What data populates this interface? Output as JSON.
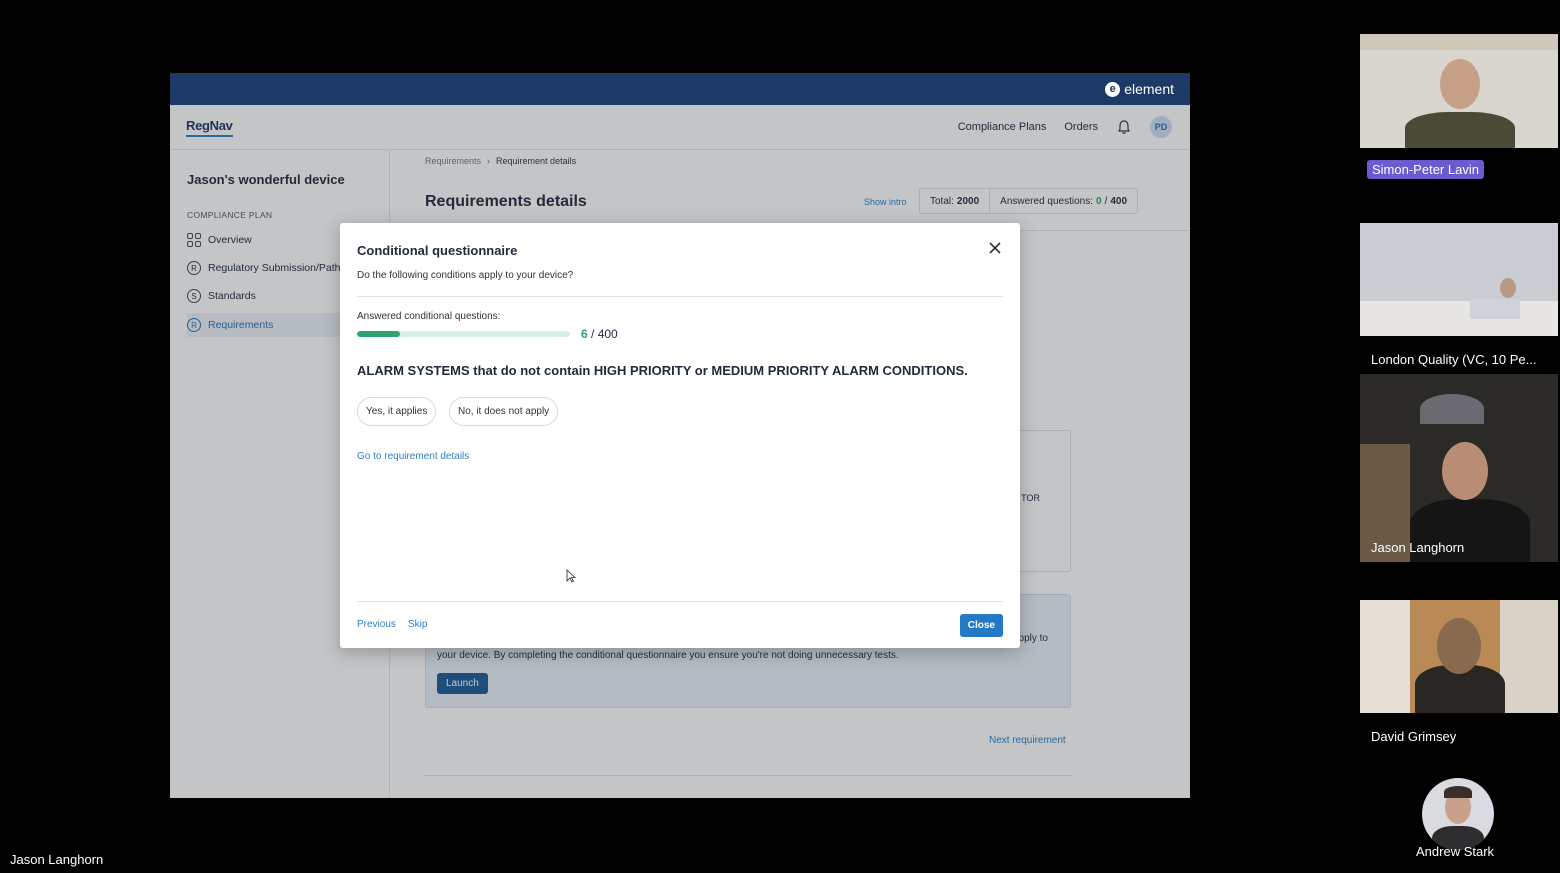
{
  "meeting": {
    "presenter_name": "Jason Langhorn",
    "participants": [
      {
        "name": "Simon-Peter Lavin",
        "highlighted": true
      },
      {
        "name": "London Quality (VC, 10 Pe..."
      },
      {
        "name": "Jason Langhorn"
      },
      {
        "name": "David Grimsey"
      },
      {
        "name": "Andrew Stark"
      }
    ]
  },
  "app": {
    "brand": "element",
    "logo": "RegNav",
    "nav": {
      "compliance_plans": "Compliance Plans",
      "orders": "Orders",
      "avatar_initials": "PD",
      "bell_icon": "bell-icon"
    },
    "sidebar": {
      "device_name": "Jason's wonderful device",
      "section_label": "COMPLIANCE PLAN",
      "items": [
        {
          "label": "Overview",
          "icon": "grid-icon"
        },
        {
          "label": "Regulatory Submission/Path",
          "icon": "R"
        },
        {
          "label": "Standards",
          "icon": "S"
        },
        {
          "label": "Requirements",
          "icon": "R",
          "active": true
        }
      ]
    },
    "page": {
      "breadcrumb": [
        "Requirements",
        "Requirement details"
      ],
      "title": "Requirements details",
      "show_intro": "Show intro",
      "total_label": "Total:",
      "total_value": "2000",
      "answered_label": "Answered questions:",
      "answered_value": "0",
      "answered_sep": "/",
      "answered_total": "400",
      "card1_fragment": "TOR",
      "card2_text1": "pply to",
      "card2_text2": "your device. By completing the conditional questionnaire you ensure you're not doing unnecessary tests.",
      "launch": "Launch",
      "next_requirement": "Next requirement"
    }
  },
  "modal": {
    "title": "Conditional questionnaire",
    "subtitle": "Do the following conditions apply to your device?",
    "progress_label": "Answered conditional questions:",
    "progress_done": "6",
    "progress_sep": " / ",
    "progress_total": "400",
    "progress_fraction": 0.2,
    "question": "ALARM SYSTEMS that do not contain HIGH PRIORITY or MEDIUM PRIORITY ALARM CONDITIONS.",
    "yes_option": "Yes, it applies",
    "no_option": "No, it does not apply",
    "details_link": "Go to requirement details",
    "previous": "Previous",
    "skip": "Skip",
    "close": "Close"
  },
  "colors": {
    "brand_navy": "#1d3a66",
    "accent_blue": "#2379c4",
    "progress_green": "#2ea36f",
    "badge_purple": "#6a5bd1"
  }
}
